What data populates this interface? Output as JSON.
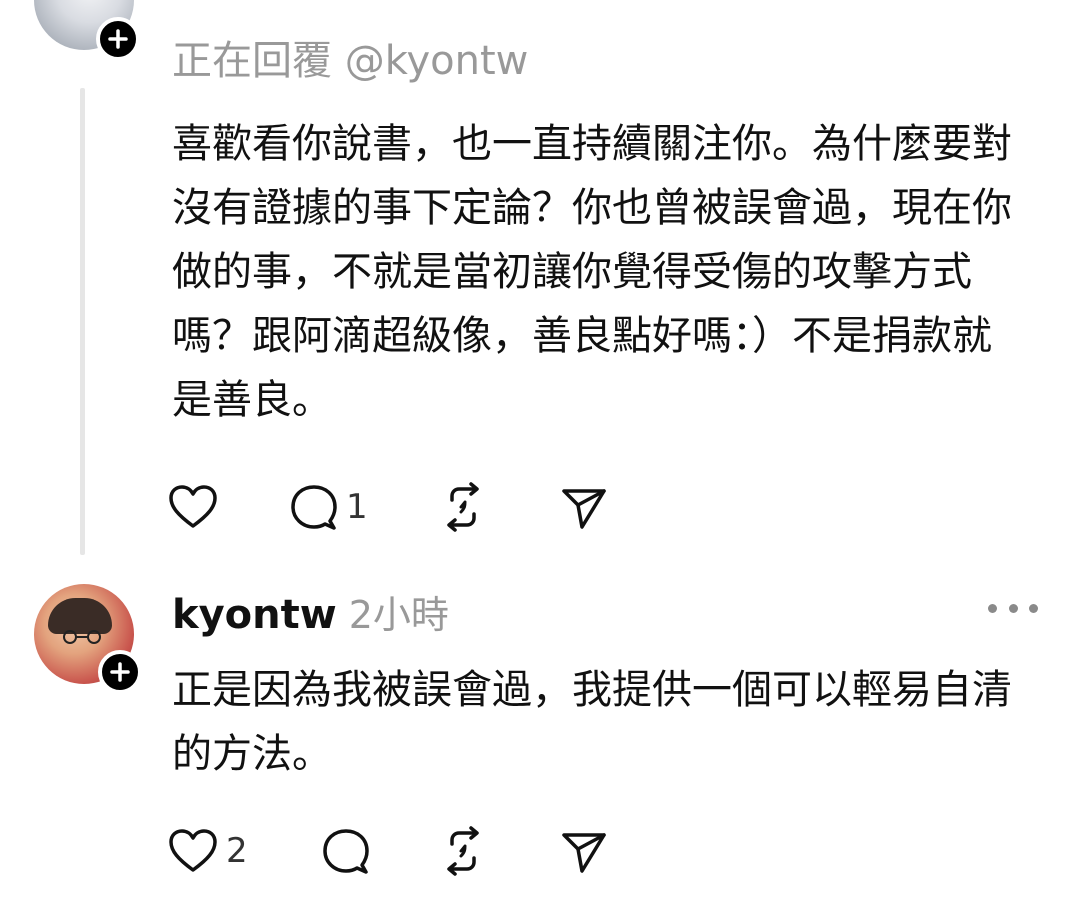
{
  "reply_post": {
    "replying_to": "正在回覆 @kyontw",
    "text": "喜歡看你說書，也一直持續關注你。為什麼要對沒有證據的事下定論？你也曾被誤會過，現在你做的事，不就是當初讓你覺得受傷的攻擊方式嗎？跟阿滴超級像，善良點好嗎：）不是捐款就是善良。",
    "comment_count": "1"
  },
  "comment_post": {
    "author": "kyontw",
    "time": "2小時",
    "text": "正是因為我被誤會過，我提供一個可以輕易自清的方法。",
    "like_count": "2"
  },
  "icons": {
    "follow": "plus-icon",
    "like": "heart-icon",
    "comment": "comment-bubble-icon",
    "repost": "repost-icon",
    "share": "paper-plane-icon",
    "more": "more-dots-icon"
  },
  "colors": {
    "text": "#111111",
    "secondary_text": "#999999",
    "thread_line": "#e6e6e6",
    "badge": "#000000"
  }
}
